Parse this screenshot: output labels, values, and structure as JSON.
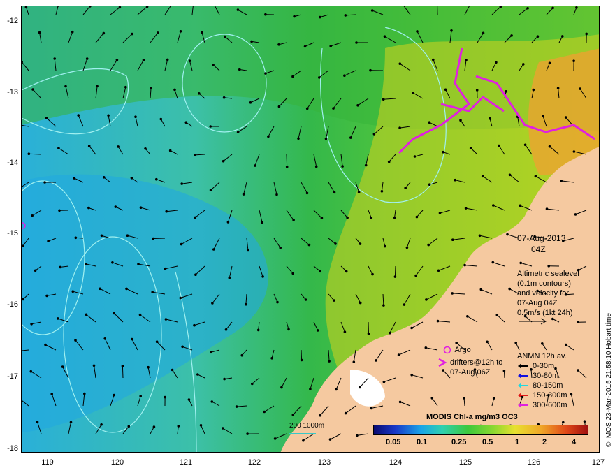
{
  "map": {
    "lat_ticks": [
      "-12",
      "-13",
      "-14",
      "-15",
      "-16",
      "-17",
      "-18"
    ],
    "lon_ticks": [
      "119",
      "120",
      "121",
      "122",
      "123",
      "124",
      "125",
      "126",
      "127"
    ]
  },
  "panel": {
    "date": "07-Aug-2013",
    "time": "04Z",
    "altimetry_lines": [
      "Altimetric sealevel",
      "(0.1m contours)",
      "and velocity for",
      "07-Aug 04Z",
      "0.5m/s (1kt 24h)"
    ]
  },
  "legend": {
    "argo_label": "Argo",
    "drifters_label_1": "drifters@12h to",
    "drifters_label_2": "07-Aug 06Z",
    "anmn_title": "ANMN 12h av.",
    "depths": [
      {
        "label": "0-30m",
        "color": "#000000"
      },
      {
        "label": "30-80m",
        "color": "#1010e0"
      },
      {
        "label": "80-150m",
        "color": "#20d8e0"
      },
      {
        "label": "150-300m",
        "color": "#e01818"
      },
      {
        "label": "300-600m",
        "color": "#e020e0"
      }
    ]
  },
  "scalebar": {
    "label": "200  1000m"
  },
  "colorbar": {
    "title": "MODIS Chl-a mg/m3 OC3",
    "ticks": [
      "0.05",
      "0.1",
      "0.25",
      "0.5",
      "1",
      "2",
      "4"
    ]
  },
  "footer": {
    "credit": "© IMOS 23-Mar-2015 21:58:10 Hobart time"
  },
  "colors": {
    "land": "#f5c9a0",
    "contour": "#a0f0f0",
    "argo": "#e020e0"
  }
}
